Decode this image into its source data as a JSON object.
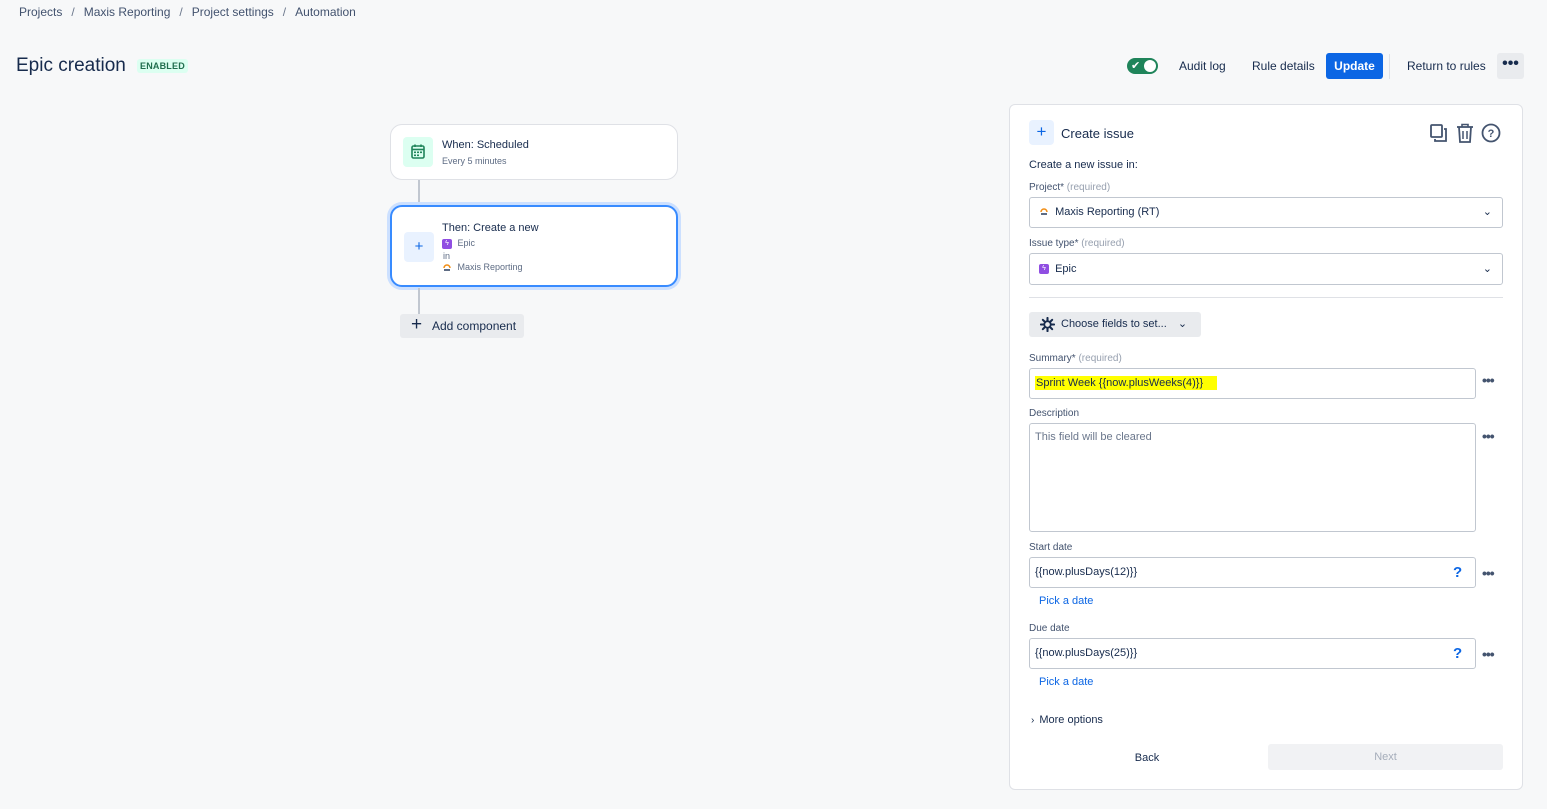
{
  "breadcrumb": {
    "items": [
      "Projects",
      "Maxis Reporting",
      "Project settings",
      "Automation"
    ]
  },
  "header": {
    "title": "Epic creation",
    "status": "ENABLED",
    "audit_log": "Audit log",
    "rule_details": "Rule details",
    "update": "Update",
    "return_to_rules": "Return to rules",
    "enabled_toggle": true
  },
  "flow": {
    "trigger": {
      "title": "When: Scheduled",
      "subtitle": "Every 5 minutes",
      "icon": "calendar-icon"
    },
    "action": {
      "title": "Then: Create a new",
      "issue_type": "Epic",
      "in_label": "in",
      "project": "Maxis Reporting",
      "icon": "plus-icon"
    },
    "add_component": "Add component"
  },
  "panel": {
    "title": "Create issue",
    "intro": "Create a new issue in:",
    "project": {
      "label": "Project",
      "required": "(required)",
      "value": "Maxis Reporting (RT)"
    },
    "issue_type": {
      "label": "Issue type",
      "required": "(required)",
      "value": "Epic"
    },
    "choose_fields": "Choose fields to set...",
    "summary": {
      "label": "Summary",
      "required": "(required)",
      "value": "Sprint Week {{now.plusWeeks(4)}}"
    },
    "description": {
      "label": "Description",
      "placeholder": "This field will be cleared"
    },
    "start_date": {
      "label": "Start date",
      "value": "{{now.plusDays(12)}}",
      "pick": "Pick a date"
    },
    "due_date": {
      "label": "Due date",
      "value": "{{now.plusDays(25)}}",
      "pick": "Pick a date"
    },
    "more_options": "More options",
    "back": "Back",
    "next": "Next"
  },
  "colors": {
    "primary": "#0c66e4",
    "enabled_green": "#1f845a",
    "highlight": "#ffff00",
    "epic_purple": "#904ee2"
  }
}
